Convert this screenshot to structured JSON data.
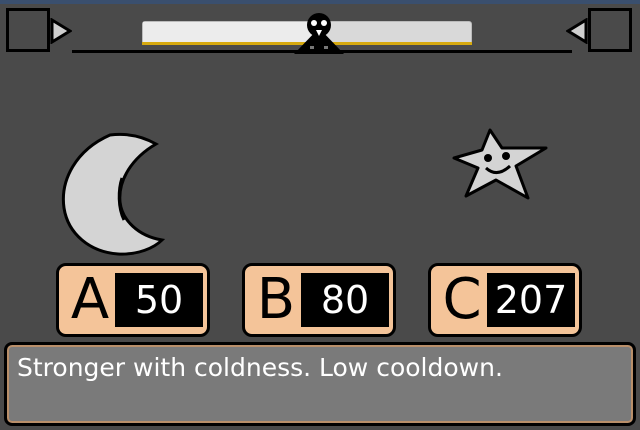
{
  "hud": {
    "gauge_fill": 0.55,
    "colors": {
      "gauge": "#d9d9d9",
      "gauge_accent": "#d6a90f",
      "background": "#4a4a4a",
      "stat_bg": "#f4c499"
    },
    "left_marker_icon": "box-marker-icon",
    "right_marker_icon": "box-marker-icon",
    "indicator_icon": "bird-marker-icon"
  },
  "enemies": [
    {
      "icon": "crescent-moon-icon"
    },
    {
      "icon": "smiling-star-icon"
    }
  ],
  "stats": [
    {
      "letter": "A",
      "value": "50"
    },
    {
      "letter": "B",
      "value": "80"
    },
    {
      "letter": "C",
      "value": "207"
    }
  ],
  "description": "Stronger with coldness. Low cooldown."
}
